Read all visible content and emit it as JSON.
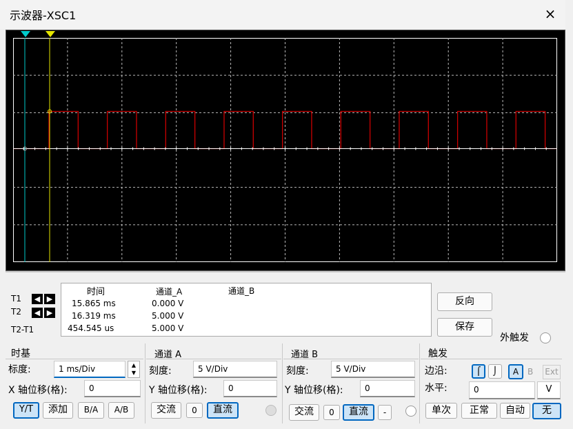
{
  "window": {
    "title": "示波器-XSC1",
    "close_label": "×"
  },
  "cursors": {
    "t1_label": "T1",
    "t2_label": "T2",
    "t21_label": "T2-T1",
    "left_arrow": "🡄",
    "right_arrow": "🡆"
  },
  "readout": {
    "headers": [
      "时间",
      "通道_A",
      "通道_B"
    ],
    "rows": [
      {
        "time": "15.865 ms",
        "a": "0.000 V",
        "b": ""
      },
      {
        "time": "16.319 ms",
        "a": "5.000 V",
        "b": ""
      },
      {
        "time": "454.545 us",
        "a": "5.000 V",
        "b": ""
      }
    ]
  },
  "buttons": {
    "reverse": "反向",
    "save": "保存",
    "ext_trigger": "外触发"
  },
  "timebase": {
    "title": "时基",
    "scale_label": "标度:",
    "scale_value": "1 ms/Div",
    "xpos_label": "X 轴位移(格):",
    "xpos_value": "0",
    "modes": [
      "Y/T",
      "添加",
      "B/A",
      "A/B"
    ],
    "active_mode": "Y/T"
  },
  "channel_a": {
    "title": "通道 A",
    "scale_label": "刻度:",
    "scale_value": "5  V/Div",
    "ypos_label": "Y 轴位移(格):",
    "ypos_value": "0",
    "coupling": [
      "交流",
      "0",
      "直流"
    ],
    "active": "直流"
  },
  "channel_b": {
    "title": "通道 B",
    "scale_label": "刻度:",
    "scale_value": "5  V/Div",
    "ypos_label": "Y 轴位移(格):",
    "ypos_value": "0",
    "coupling": [
      "交流",
      "0",
      "直流",
      "-"
    ],
    "active": "直流"
  },
  "trigger": {
    "title": "触发",
    "edge_label": "边沿:",
    "level_label": "水平:",
    "level_value": "0",
    "level_unit": "V",
    "edge_buttons": [
      "A",
      "B",
      "Ext"
    ],
    "active_source": "A",
    "modes": [
      "单次",
      "正常",
      "自动",
      "无"
    ],
    "active_mode": "无"
  },
  "colors": {
    "trace_a": "#cc0000",
    "cursor1": "#00cccc",
    "cursor2": "#e6e600",
    "grid": "#ffffff",
    "accent": "#0067c0"
  }
}
